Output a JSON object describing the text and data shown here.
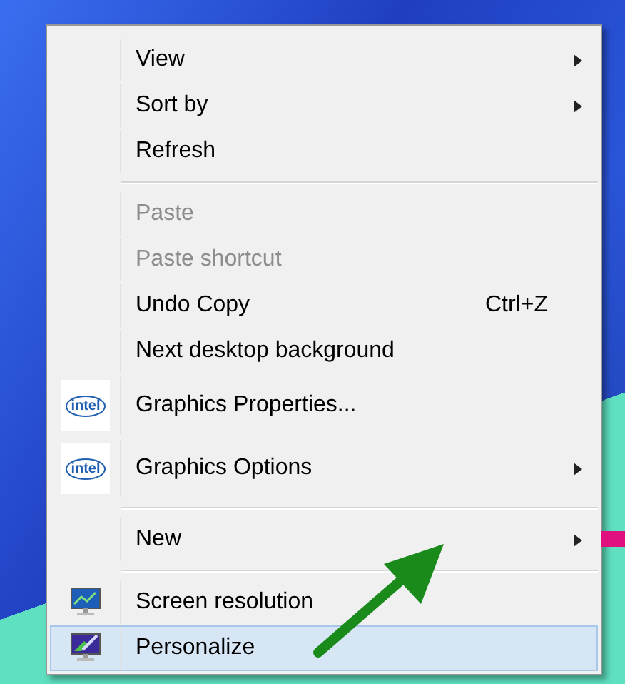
{
  "context_menu": {
    "groups": [
      {
        "items": [
          {
            "label": "View",
            "submenu": true,
            "disabled": false,
            "selected": false
          },
          {
            "label": "Sort by",
            "submenu": true,
            "disabled": false,
            "selected": false
          },
          {
            "label": "Refresh",
            "submenu": false,
            "disabled": false,
            "selected": false
          }
        ]
      },
      {
        "items": [
          {
            "label": "Paste",
            "submenu": false,
            "disabled": true,
            "selected": false
          },
          {
            "label": "Paste shortcut",
            "submenu": false,
            "disabled": true,
            "selected": false
          },
          {
            "label": "Undo Copy",
            "shortcut": "Ctrl+Z",
            "submenu": false,
            "disabled": false,
            "selected": false
          },
          {
            "label": "Next desktop background",
            "submenu": false,
            "disabled": false,
            "selected": false
          },
          {
            "label": "Graphics Properties...",
            "kind": "logo",
            "logo_text": "intel",
            "submenu": false,
            "disabled": false,
            "selected": false
          },
          {
            "label": "Graphics Options",
            "kind": "logo",
            "logo_text": "intel",
            "submenu": true,
            "disabled": false,
            "selected": false
          }
        ]
      },
      {
        "items": [
          {
            "label": "New",
            "submenu": true,
            "disabled": false,
            "selected": false
          }
        ]
      },
      {
        "items": [
          {
            "label": "Screen resolution",
            "kind": "monitor-chart",
            "submenu": false,
            "disabled": false,
            "selected": false
          },
          {
            "label": "Personalize",
            "kind": "monitor-brush",
            "submenu": false,
            "disabled": false,
            "selected": true
          }
        ]
      }
    ]
  }
}
